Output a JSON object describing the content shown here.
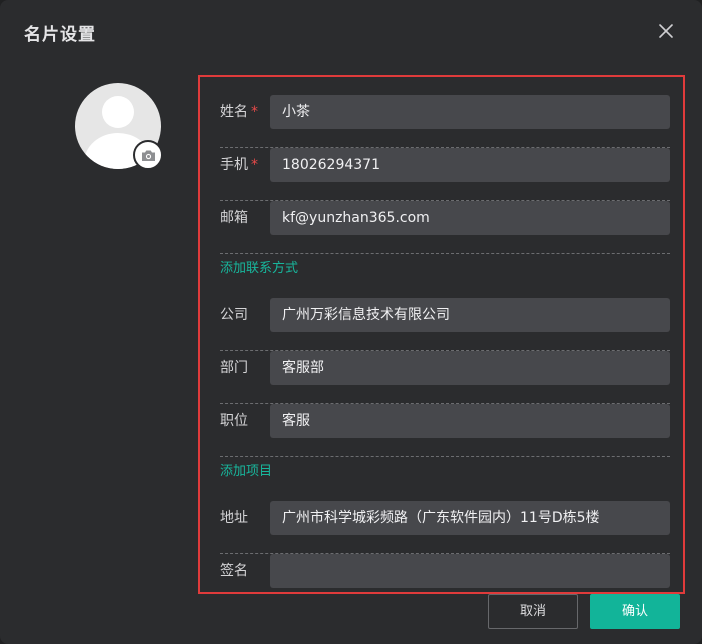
{
  "dialog": {
    "title": "名片设置"
  },
  "form": {
    "fields": [
      {
        "label": "姓名",
        "required": true,
        "value": "小茶"
      },
      {
        "label": "手机",
        "required": true,
        "value": "18026294371"
      },
      {
        "label": "邮箱",
        "required": false,
        "value": "kf@yunzhan365.com"
      },
      {
        "label": "公司",
        "required": false,
        "value": "广州万彩信息技术有限公司"
      },
      {
        "label": "部门",
        "required": false,
        "value": "客服部"
      },
      {
        "label": "职位",
        "required": false,
        "value": "客服"
      },
      {
        "label": "地址",
        "required": false,
        "value": "广州市科学城彩频路（广东软件园内）11号D栋5楼"
      },
      {
        "label": "签名",
        "required": false,
        "value": ""
      }
    ],
    "required_mark": "*",
    "add_contact_link": "添加联系方式",
    "add_item_link": "添加项目"
  },
  "footer": {
    "cancel_label": "取消",
    "confirm_label": "确认"
  },
  "colors": {
    "accent": "#12b499",
    "required": "#e84a4a",
    "highlight_border": "#e03b3b"
  },
  "icons": {
    "close": "close-icon",
    "camera": "camera-icon",
    "avatar": "avatar-placeholder-icon"
  }
}
